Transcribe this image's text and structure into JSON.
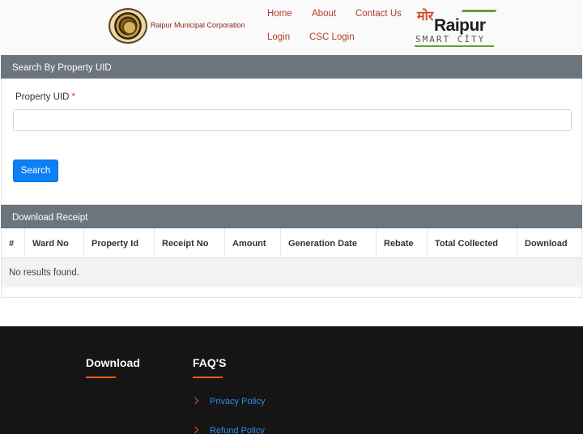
{
  "header": {
    "org_name": "Raipur Municipal Corporation",
    "nav": {
      "home": "Home",
      "about": "About",
      "contact": "Contact Us",
      "login": "Login",
      "csc_login": "CSC Login"
    },
    "smart_city_logo": {
      "more": "मोर",
      "raipur": "Raipur",
      "smart_city": "SMART CİTY"
    }
  },
  "search_section": {
    "title": "Search By Property UID",
    "field_label": "Property UID",
    "required_mark": "*",
    "input_value": "",
    "button_label": "Search"
  },
  "receipt_section": {
    "title": "Download Receipt",
    "columns": [
      "#",
      "Ward No",
      "Property Id",
      "Receipt No",
      "Amount",
      "Generation Date",
      "Rebate",
      "Total Collected",
      "Download"
    ],
    "empty_message": "No results found."
  },
  "footer": {
    "col1_title": "Download",
    "col2_title": "FAQ'S",
    "links": [
      "Privacy Policy",
      "Refund Policy"
    ]
  },
  "colors": {
    "card_header": "#6c757d",
    "primary_button": "#0d7ff7",
    "nav_link": "#b23c2a",
    "footer_bg": "#151515",
    "footer_accent": "#e25c17",
    "footer_link": "#2f8bf0"
  }
}
